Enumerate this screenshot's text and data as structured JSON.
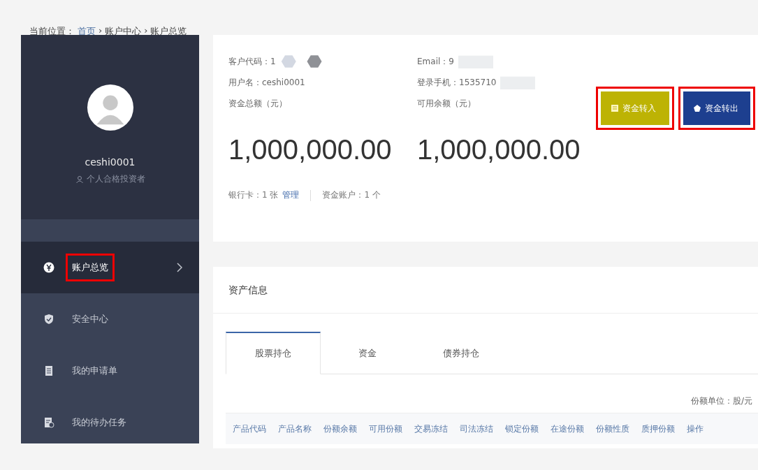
{
  "breadcrumb": [
    {
      "label": "当前位置："
    },
    {
      "label": "首页",
      "link": true
    },
    {
      "label": "›"
    },
    {
      "label": "账户中心"
    },
    {
      "label": "›"
    },
    {
      "label": "账户总览"
    }
  ],
  "sidebar": {
    "username": "ceshi0001",
    "role": "个人合格投资者",
    "items": [
      {
        "label": "账户总览",
        "selected": true,
        "highlighted": true
      },
      {
        "label": "安全中心",
        "selected": false,
        "highlighted": false
      },
      {
        "label": "我的申请单",
        "selected": false,
        "highlighted": false
      },
      {
        "label": "我的待办任务",
        "selected": false,
        "highlighted": false
      }
    ]
  },
  "account": {
    "fields": [
      {
        "label": "客户代码：1"
      },
      {
        "label": "Email：9"
      },
      {
        "label": "用户名：ceshi0001"
      },
      {
        "label": "登录手机：1535710"
      },
      {
        "label": "资金总额（元）"
      },
      {
        "label": "可用余额（元）"
      }
    ],
    "amounts": [
      "1,000,000.00",
      "1,000,000.00"
    ],
    "bank_card": "银行卡：1 张",
    "manage_link": "管理",
    "fund_accounts": "资金账户：1 个",
    "buttons": [
      {
        "label": "资金转入",
        "kind": "in",
        "highlighted": true
      },
      {
        "label": "资金转出",
        "kind": "out",
        "highlighted": true
      }
    ]
  },
  "assets": {
    "title": "资产信息",
    "tabs": [
      {
        "label": "股票持仓",
        "selected": true
      },
      {
        "label": "资金",
        "selected": false
      },
      {
        "label": "债券持仓",
        "selected": false
      }
    ],
    "unit": "份额单位：股/元",
    "columns": [
      "产品代码",
      "产品名称",
      "份额余额",
      "可用份额",
      "交易冻结",
      "司法冻结",
      "锁定份额",
      "在途份额",
      "份额性质",
      "质押份额",
      "操作"
    ]
  }
}
